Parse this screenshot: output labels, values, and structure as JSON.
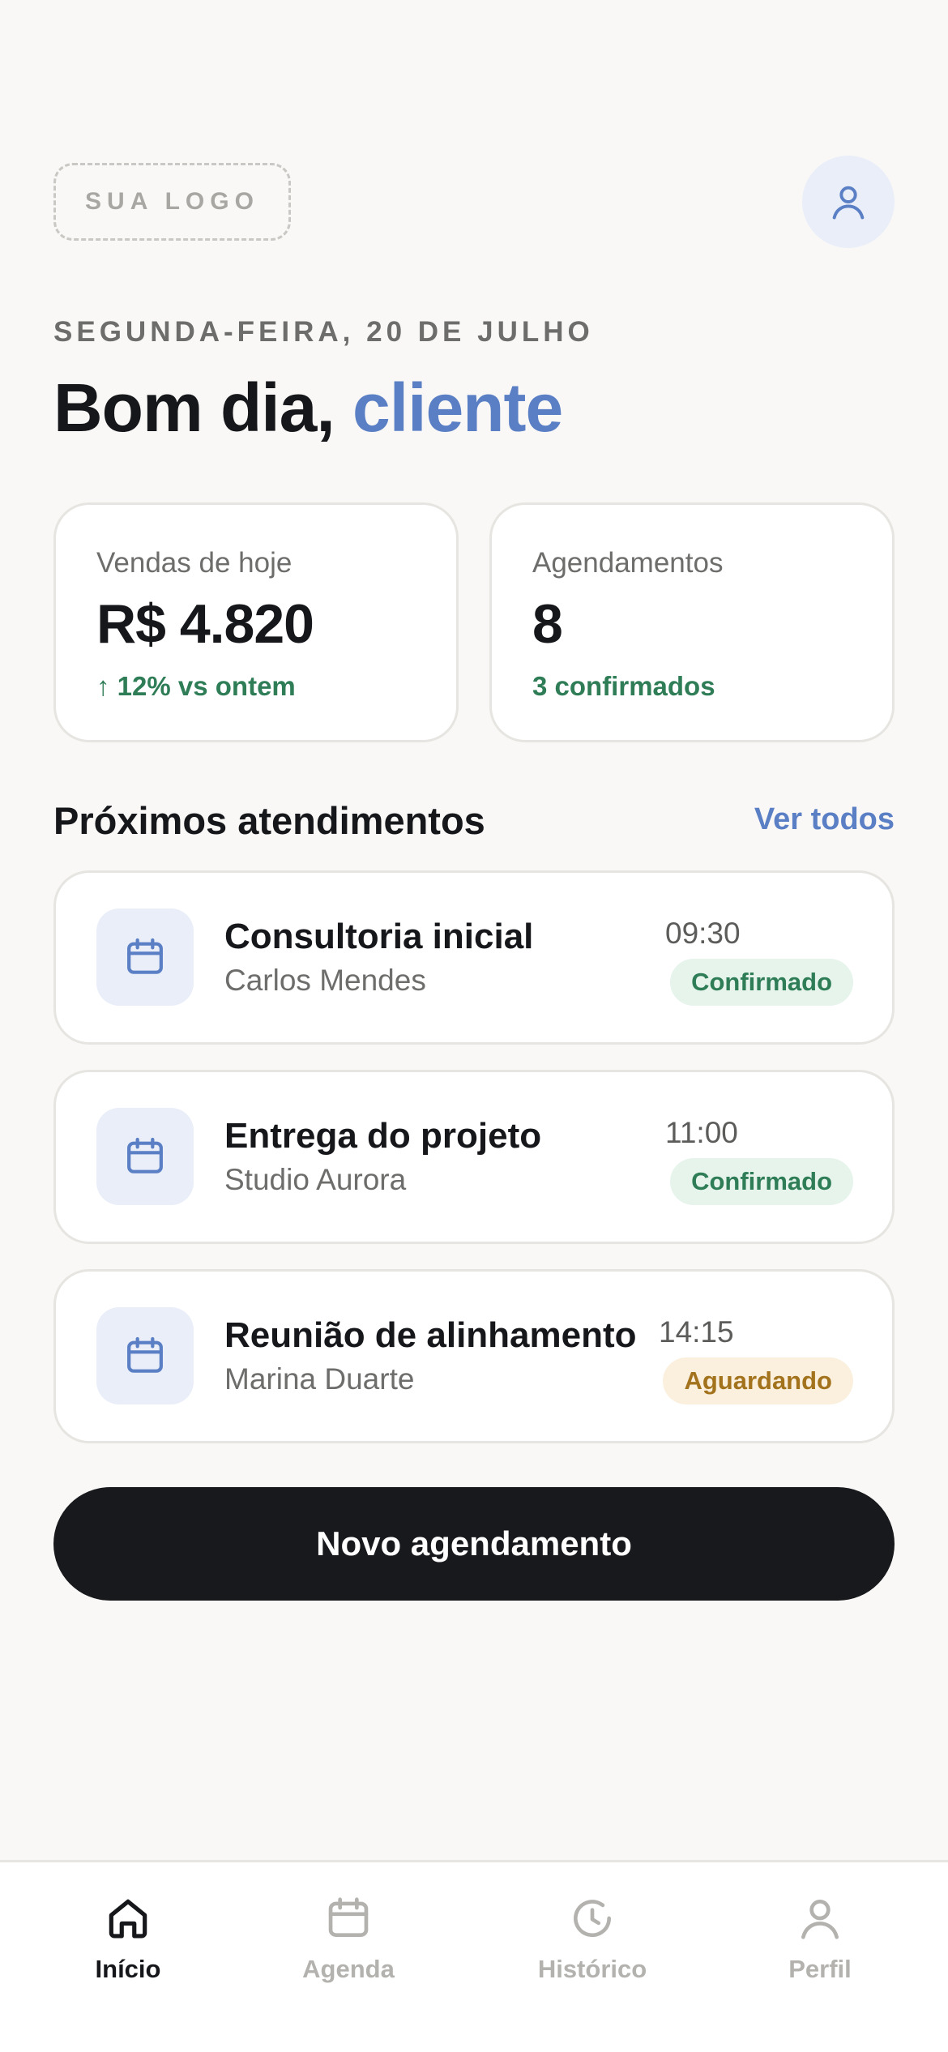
{
  "header": {
    "logo_text": "SUA LOGO",
    "date": "SEGUNDA-FEIRA, 20 DE JULHO",
    "greeting_prefix": "Bom dia, ",
    "greeting_name": "cliente"
  },
  "stats": [
    {
      "label": "Vendas de hoje",
      "value": "R$ 4.820",
      "note": "↑ 12% vs ontem"
    },
    {
      "label": "Agendamentos",
      "value": "8",
      "note": "3 confirmados"
    }
  ],
  "section": {
    "title": "Próximos atendimentos",
    "see_all": "Ver todos"
  },
  "appointments": [
    {
      "title": "Consultoria inicial",
      "client": "Carlos Mendes",
      "time": "09:30",
      "status": "Confirmado"
    },
    {
      "title": "Entrega do projeto",
      "client": "Studio Aurora",
      "time": "11:00",
      "status": "Confirmado"
    },
    {
      "title": "Reunião de alinhamento",
      "client": "Marina Duarte",
      "time": "14:15",
      "status": "Aguardando"
    }
  ],
  "cta": {
    "label": "Novo agendamento"
  },
  "nav": [
    {
      "label": "Início",
      "icon": "home-icon",
      "active": true
    },
    {
      "label": "Agenda",
      "icon": "calendar-icon",
      "active": false
    },
    {
      "label": "Histórico",
      "icon": "clock-icon",
      "active": false
    },
    {
      "label": "Perfil",
      "icon": "user-icon",
      "active": false
    }
  ],
  "colors": {
    "accent": "#5a7fc5",
    "success": "#2e7d57",
    "warning": "#a3721c",
    "dark": "#18191c",
    "background": "#f9f8f6"
  }
}
